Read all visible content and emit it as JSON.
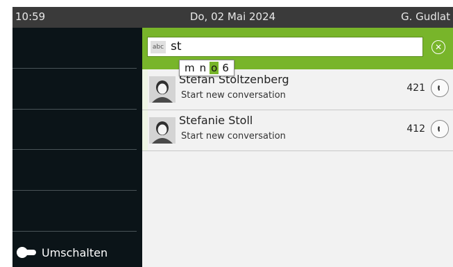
{
  "status_bar": {
    "time": "10:59",
    "date": "Do, 02 Mai 2024",
    "user": "G. Gudlat"
  },
  "sidebar": {
    "toggle_label": "Umschalten"
  },
  "search": {
    "mode_badge": "abc",
    "value": "st",
    "clear_icon": "close-icon"
  },
  "keypad_hint": {
    "chars": [
      {
        "char": "m",
        "selected": false
      },
      {
        "char": "n",
        "selected": false
      },
      {
        "char": "o",
        "selected": true
      },
      {
        "char": "6",
        "selected": false
      }
    ]
  },
  "results": [
    {
      "name": "Stefan Stoltzenberg",
      "subtitle": "Start new conversation",
      "extension": "421"
    },
    {
      "name": "Stefanie Stoll",
      "subtitle": "Start new conversation",
      "extension": "412"
    }
  ],
  "colors": {
    "accent": "#78b52a",
    "sidebar": "#0b1418",
    "status_bar": "#3a3a3a"
  }
}
